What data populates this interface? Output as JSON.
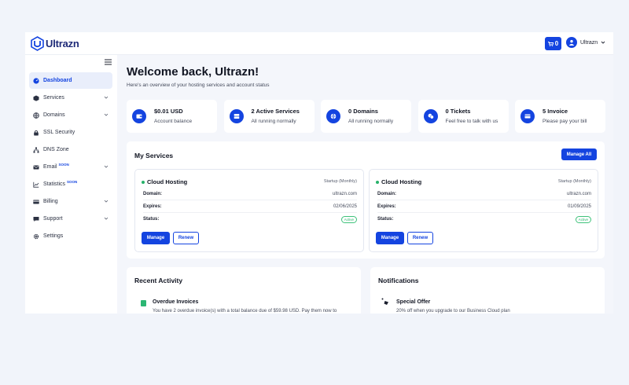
{
  "brand": {
    "name": "Ultrazn",
    "color": "#1444e0"
  },
  "header": {
    "cart_count": "0",
    "user_name": "Ultrazn",
    "cart_icon": "cart-icon",
    "avatar_icon": "user-icon"
  },
  "sidebar": {
    "items": [
      {
        "label": "Dashboard",
        "icon": "dashboard-icon",
        "active": true,
        "chevron": false,
        "badge": ""
      },
      {
        "label": "Services",
        "icon": "box-icon",
        "active": false,
        "chevron": true,
        "badge": ""
      },
      {
        "label": "Domains",
        "icon": "globe-icon",
        "active": false,
        "chevron": true,
        "badge": ""
      },
      {
        "label": "SSL Security",
        "icon": "lock-icon",
        "active": false,
        "chevron": false,
        "badge": ""
      },
      {
        "label": "DNS Zone",
        "icon": "network-icon",
        "active": false,
        "chevron": false,
        "badge": ""
      },
      {
        "label": "Email",
        "icon": "mail-icon",
        "active": false,
        "chevron": true,
        "badge": "SOON"
      },
      {
        "label": "Statistics",
        "icon": "chart-icon",
        "active": false,
        "chevron": false,
        "badge": "SOON"
      },
      {
        "label": "Billing",
        "icon": "card-icon",
        "active": false,
        "chevron": true,
        "badge": ""
      },
      {
        "label": "Support",
        "icon": "chat-icon",
        "active": false,
        "chevron": true,
        "badge": ""
      },
      {
        "label": "Settings",
        "icon": "gear-icon",
        "active": false,
        "chevron": false,
        "badge": ""
      }
    ]
  },
  "main": {
    "welcome": "Welcome back, Ultrazn!",
    "subtitle": "Here's an overview of your hosting services and account status",
    "stats": [
      {
        "title": "$0.01 USD",
        "desc": "Account balance",
        "icon": "wallet-icon"
      },
      {
        "title": "2 Active Services",
        "desc": "All running normally",
        "icon": "server-icon"
      },
      {
        "title": "0 Domains",
        "desc": "All running normally",
        "icon": "globe-icon"
      },
      {
        "title": "0 Tickets",
        "desc": "Feel free to talk with us",
        "icon": "chat-icon"
      },
      {
        "title": "5 Invoice",
        "desc": "Please pay your bill",
        "icon": "invoice-icon"
      }
    ],
    "services_panel": {
      "title": "My Services",
      "manage_all": "Manage All",
      "services": [
        {
          "name": "Cloud Hosting",
          "plan": "Startup (Monthly)",
          "domain_label": "Domain:",
          "domain": "ultrazn.com",
          "expires_label": "Expires:",
          "expires": "02/06/2025",
          "status_label": "Status:",
          "status": "Active",
          "manage": "Manage",
          "renew": "Renew"
        },
        {
          "name": "Cloud Hosting",
          "plan": "Startup (Monthly)",
          "domain_label": "Domain:",
          "domain": "ultrazn.com",
          "expires_label": "Expires:",
          "expires": "01/09/2025",
          "status_label": "Status:",
          "status": "Active",
          "manage": "Manage",
          "renew": "Renew"
        }
      ]
    },
    "activity": {
      "title": "Recent Activity",
      "item_title": "Overdue Invoices",
      "item_text": "You have 2 overdue invoice(s) with a total balance due of $59.98 USD. Pay them now to"
    },
    "notifications": {
      "title": "Notifications",
      "item_title": "Special Offer",
      "item_text": "20% off when you upgrade to our Business Cloud plan"
    }
  }
}
